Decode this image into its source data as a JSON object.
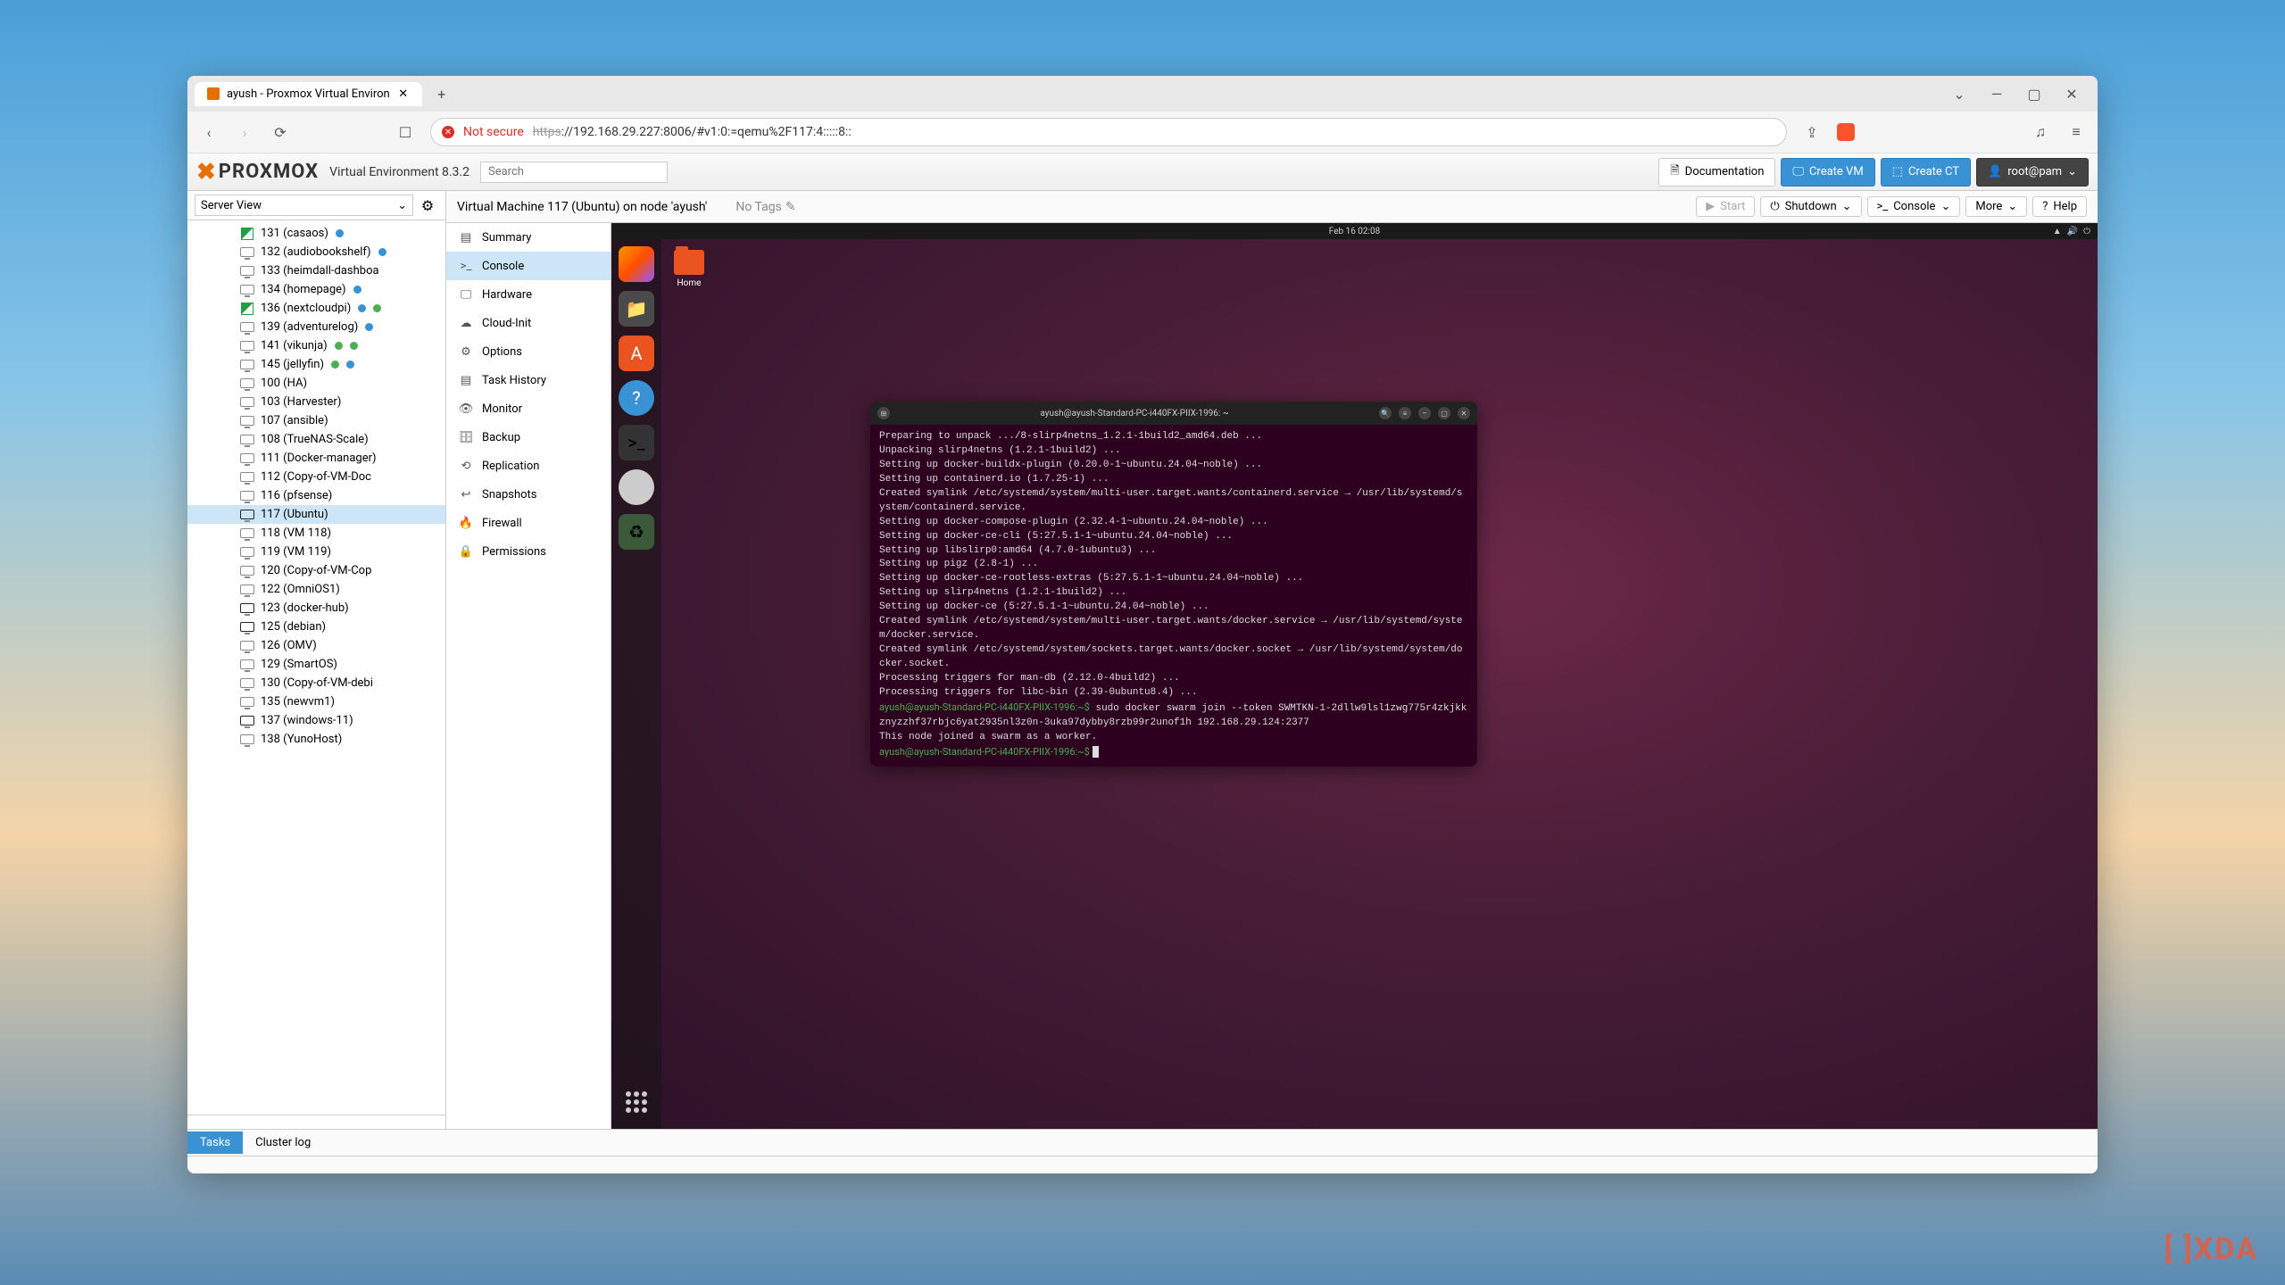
{
  "browser": {
    "tab_title": "ayush - Proxmox Virtual Environ",
    "not_secure": "Not secure",
    "url_proto": "https",
    "url_rest": "://192.168.29.227:8006/#v1:0:=qemu%2F117:4:::::8::"
  },
  "header": {
    "logo_text": "PROXMOX",
    "version": "Virtual Environment 8.3.2",
    "search_placeholder": "Search",
    "documentation": "Documentation",
    "create_vm": "Create VM",
    "create_ct": "Create CT",
    "user": "root@pam"
  },
  "sidebar": {
    "view_label": "Server View",
    "items": [
      {
        "id": "131",
        "label": "131 (casaos)",
        "type": "ct",
        "dots": [
          "blue"
        ]
      },
      {
        "id": "132",
        "label": "132 (audiobookshelf)",
        "type": "vm",
        "dots": [
          "blue"
        ]
      },
      {
        "id": "133",
        "label": "133 (heimdall-dashboa",
        "type": "vm",
        "dots": []
      },
      {
        "id": "134",
        "label": "134 (homepage)",
        "type": "vm",
        "dots": [
          "blue"
        ]
      },
      {
        "id": "136",
        "label": "136 (nextcloudpi)",
        "type": "ct",
        "dots": [
          "blue",
          "green"
        ]
      },
      {
        "id": "139",
        "label": "139 (adventurelog)",
        "type": "vm",
        "dots": [
          "blue"
        ]
      },
      {
        "id": "141",
        "label": "141 (vikunja)",
        "type": "vm",
        "dots": [
          "green",
          "green"
        ]
      },
      {
        "id": "145",
        "label": "145 (jellyfin)",
        "type": "vm",
        "dots": [
          "green",
          "blue"
        ]
      },
      {
        "id": "100",
        "label": "100 (HA)",
        "type": "vm",
        "dots": []
      },
      {
        "id": "103",
        "label": "103 (Harvester)",
        "type": "vm",
        "dots": []
      },
      {
        "id": "107",
        "label": "107 (ansible)",
        "type": "vm",
        "dots": []
      },
      {
        "id": "108",
        "label": "108 (TrueNAS-Scale)",
        "type": "vm",
        "dots": []
      },
      {
        "id": "111",
        "label": "111 (Docker-manager)",
        "type": "vm",
        "dots": []
      },
      {
        "id": "112",
        "label": "112 (Copy-of-VM-Doc",
        "type": "vm",
        "dots": []
      },
      {
        "id": "116",
        "label": "116 (pfsense)",
        "type": "vm",
        "dots": []
      },
      {
        "id": "117",
        "label": "117 (Ubuntu)",
        "type": "vm-run",
        "dots": [],
        "selected": true
      },
      {
        "id": "118",
        "label": "118 (VM 118)",
        "type": "vm",
        "dots": []
      },
      {
        "id": "119",
        "label": "119 (VM 119)",
        "type": "vm",
        "dots": []
      },
      {
        "id": "120",
        "label": "120 (Copy-of-VM-Cop",
        "type": "vm",
        "dots": []
      },
      {
        "id": "122",
        "label": "122 (OmniOS1)",
        "type": "vm",
        "dots": []
      },
      {
        "id": "123",
        "label": "123 (docker-hub)",
        "type": "vm-run",
        "dots": []
      },
      {
        "id": "125",
        "label": "125 (debian)",
        "type": "vm-run",
        "dots": []
      },
      {
        "id": "126",
        "label": "126 (OMV)",
        "type": "vm",
        "dots": []
      },
      {
        "id": "129",
        "label": "129 (SmartOS)",
        "type": "vm",
        "dots": []
      },
      {
        "id": "130",
        "label": "130 (Copy-of-VM-debi",
        "type": "vm",
        "dots": []
      },
      {
        "id": "135",
        "label": "135 (newvm1)",
        "type": "vm",
        "dots": []
      },
      {
        "id": "137",
        "label": "137 (windows-11)",
        "type": "vm-run",
        "dots": []
      },
      {
        "id": "138",
        "label": "138 (YunoHost)",
        "type": "vm",
        "dots": []
      }
    ]
  },
  "main": {
    "title": "Virtual Machine 117 (Ubuntu) on node 'ayush'",
    "no_tags": "No Tags",
    "actions": {
      "start": "Start",
      "shutdown": "Shutdown",
      "console": "Console",
      "more": "More",
      "help": "Help"
    }
  },
  "subnav": [
    {
      "label": "Summary",
      "icon": "▤"
    },
    {
      "label": "Console",
      "icon": ">_",
      "selected": true
    },
    {
      "label": "Hardware",
      "icon": "🖵"
    },
    {
      "label": "Cloud-Init",
      "icon": "☁"
    },
    {
      "label": "Options",
      "icon": "⚙"
    },
    {
      "label": "Task History",
      "icon": "▤"
    },
    {
      "label": "Monitor",
      "icon": "👁"
    },
    {
      "label": "Backup",
      "icon": "🗄"
    },
    {
      "label": "Replication",
      "icon": "⟲"
    },
    {
      "label": "Snapshots",
      "icon": "↩"
    },
    {
      "label": "Firewall",
      "icon": "🔥"
    },
    {
      "label": "Permissions",
      "icon": "🔒"
    }
  ],
  "ubuntu": {
    "time": "Feb 16  02:08",
    "home_label": "Home",
    "terminal_title": "ayush@ayush-Standard-PC-i440FX-PIIX-1996: ~",
    "terminal_lines": [
      "Preparing to unpack .../8-slirp4netns_1.2.1-1build2_amd64.deb ...",
      "Unpacking slirp4netns (1.2.1-1build2) ...",
      "Setting up docker-buildx-plugin (0.20.0-1~ubuntu.24.04~noble) ...",
      "Setting up containerd.io (1.7.25-1) ...",
      "Created symlink /etc/systemd/system/multi-user.target.wants/containerd.service → /usr/lib/systemd/system/containerd.service.",
      "Setting up docker-compose-plugin (2.32.4-1~ubuntu.24.04~noble) ...",
      "Setting up docker-ce-cli (5:27.5.1-1~ubuntu.24.04~noble) ...",
      "Setting up libslirp0:amd64 (4.7.0-1ubuntu3) ...",
      "Setting up pigz (2.8-1) ...",
      "Setting up docker-ce-rootless-extras (5:27.5.1-1~ubuntu.24.04~noble) ...",
      "Setting up slirp4netns (1.2.1-1build2) ...",
      "Setting up docker-ce (5:27.5.1-1~ubuntu.24.04~noble) ...",
      "Created symlink /etc/systemd/system/multi-user.target.wants/docker.service → /usr/lib/systemd/system/docker.service.",
      "Created symlink /etc/systemd/system/sockets.target.wants/docker.socket → /usr/lib/systemd/system/docker.socket.",
      "Processing triggers for man-db (2.12.0-4build2) ...",
      "Processing triggers for libc-bin (2.39-0ubuntu8.4) ..."
    ],
    "prompt1": "ayush@ayush-Standard-PC-i440FX-PIIX-1996:~$",
    "cmd1": " sudo docker swarm join --token SWMTKN-1-2dllw9lsl1zwg775r4zkjkkznyzzhf37rbjc6yat2935nl3z0n-3uka97dybby8rzb99r2unof1h 192.168.29.124:2377",
    "joined": "This node joined a swarm as a worker.",
    "prompt2": "ayush@ayush-Standard-PC-i440FX-PIIX-1996:~$ "
  },
  "footer": {
    "tasks": "Tasks",
    "cluster": "Cluster log"
  }
}
